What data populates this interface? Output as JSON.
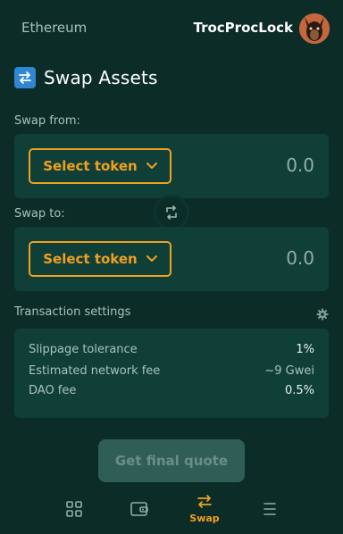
{
  "header": {
    "network": "Ethereum",
    "account_name": "TrocProcLock"
  },
  "page": {
    "title": "Swap Assets"
  },
  "swap_from": {
    "label": "Swap from:",
    "token_button": "Select token",
    "amount": "0.0"
  },
  "swap_to": {
    "label": "Swap to:",
    "token_button": "Select token",
    "amount": "0.0"
  },
  "settings": {
    "label": "Transaction settings",
    "rows": [
      {
        "key": "Slippage tolerance",
        "value": "1%"
      },
      {
        "key": "Estimated network fee",
        "value": "~9 Gwei"
      },
      {
        "key": "DAO fee",
        "value": "0.5%"
      }
    ]
  },
  "actions": {
    "quote_button": "Get final quote"
  },
  "nav": {
    "items": [
      {
        "icon": "grid-icon",
        "label": ""
      },
      {
        "icon": "wallet-icon",
        "label": ""
      },
      {
        "icon": "swap-icon",
        "label": "Swap",
        "active": true
      },
      {
        "icon": "menu-icon",
        "label": ""
      }
    ]
  },
  "colors": {
    "background": "#0b2c27",
    "panel": "#0f3f37",
    "accent": "#f0a020",
    "badge": "#2f86d3",
    "disabled_button": "#2f5e57"
  }
}
